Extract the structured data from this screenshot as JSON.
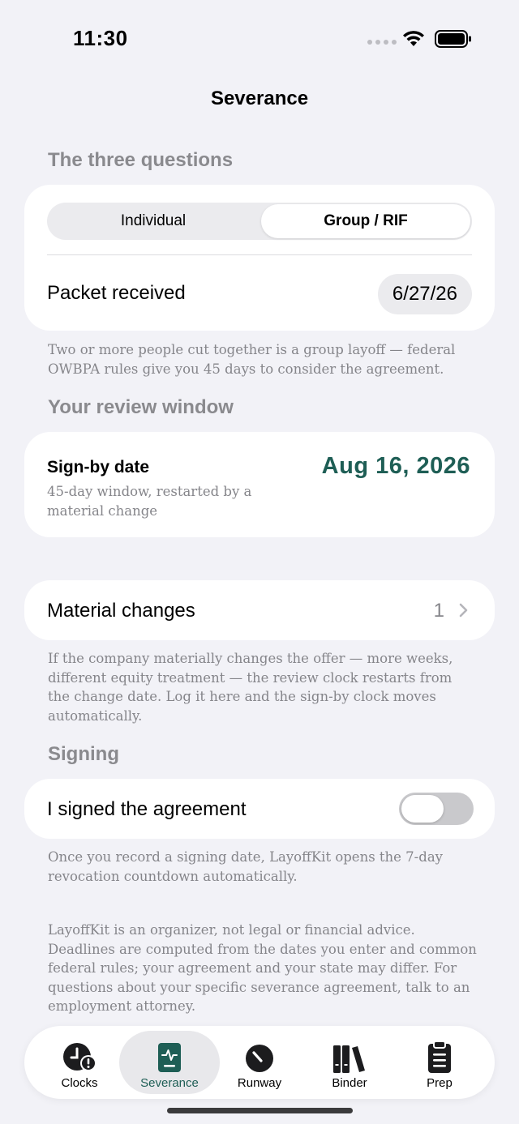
{
  "status": {
    "time": "11:30"
  },
  "nav": {
    "title": "Severance"
  },
  "questions": {
    "header": "The three questions",
    "segments": [
      "Individual",
      "Group / RIF"
    ],
    "selected": "Group / RIF",
    "packet_label": "Packet received",
    "packet_date": "6/27/26",
    "footnote": "Two or more people cut together is a group layoff — federal OWBPA rules give you 45 days to consider the agreement."
  },
  "review": {
    "header": "Your review window",
    "sign_by_label": "Sign-by date",
    "sign_by_sub": "45-day window, restarted by a material change",
    "sign_by_date": "Aug 16, 2026"
  },
  "material": {
    "label": "Material changes",
    "count": "1",
    "footnote": "If the company materially changes the offer — more weeks, different equity treatment — the review clock restarts from the change date. Log it here and the sign-by clock moves automatically."
  },
  "signing": {
    "header": "Signing",
    "toggle_label": "I signed the agreement",
    "toggle_on": false,
    "footnote": "Once you record a signing date, LayoffKit opens the 7-day revocation countdown automatically."
  },
  "disclaimer": "LayoffKit is an organizer, not legal or financial advice. Deadlines are computed from the dates you enter and common federal rules; your agreement and your state may differ. For questions about your specific severance agreement, talk to an employment attorney.",
  "tabs": [
    {
      "label": "Clocks",
      "icon": "clock-alert-icon"
    },
    {
      "label": "Severance",
      "icon": "document-pulse-icon",
      "active": true
    },
    {
      "label": "Runway",
      "icon": "gauge-icon"
    },
    {
      "label": "Binder",
      "icon": "books-icon"
    },
    {
      "label": "Prep",
      "icon": "clipboard-icon"
    }
  ],
  "colors": {
    "accent": "#1e5e55",
    "background": "#f2f2f7",
    "secondary_text": "#85858a"
  }
}
